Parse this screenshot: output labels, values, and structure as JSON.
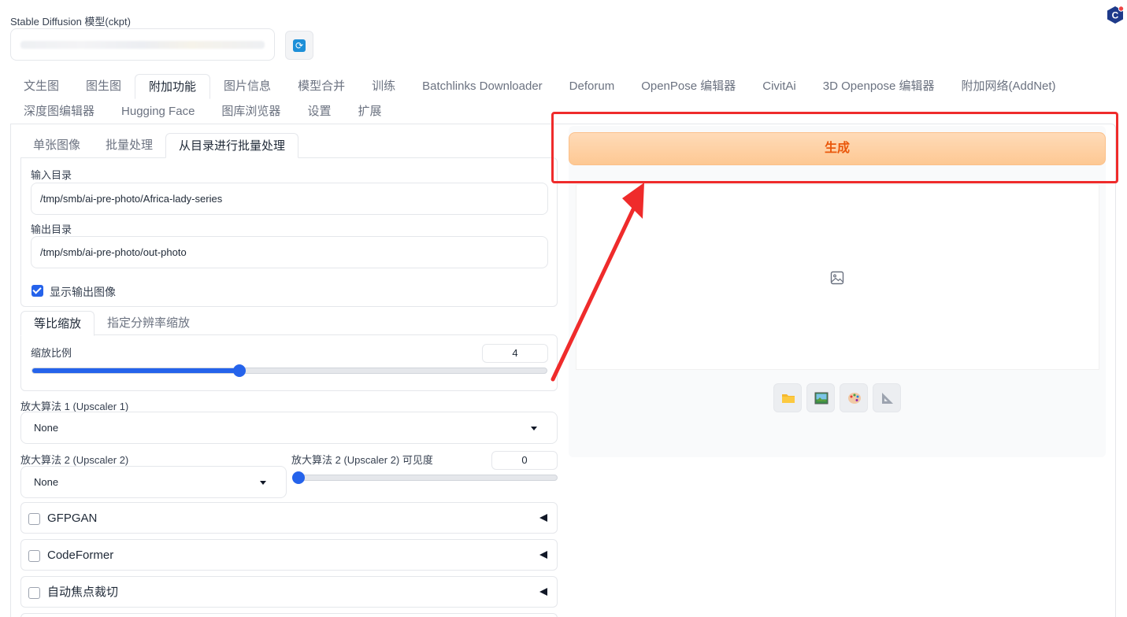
{
  "model": {
    "label": "Stable Diffusion 模型(ckpt)"
  },
  "tabs_row1": [
    "文生图",
    "图生图",
    "附加功能",
    "图片信息",
    "模型合并",
    "训练",
    "Batchlinks Downloader",
    "Deforum",
    "OpenPose 编辑器",
    "CivitAi",
    "3D Openpose 编辑器",
    "附加网络(AddNet)"
  ],
  "tabs_row2": [
    "深度图编辑器",
    "Hugging Face",
    "图库浏览器",
    "设置",
    "扩展"
  ],
  "active_tab": "附加功能",
  "subtabs": [
    "单张图像",
    "批量处理",
    "从目录进行批量处理"
  ],
  "active_subtab": "从目录进行批量处理",
  "batch_dir": {
    "input_label": "输入目录",
    "input_value": "/tmp/smb/ai-pre-photo/Africa-lady-series",
    "output_label": "输出目录",
    "output_value": "/tmp/smb/ai-pre-photo/out-photo",
    "show_output_label": "显示输出图像",
    "show_output_checked": true
  },
  "resize_tabs": [
    "等比缩放",
    "指定分辨率缩放"
  ],
  "active_resize_tab": "等比缩放",
  "scale": {
    "label": "缩放比例",
    "value": "4",
    "min": 1,
    "max": 8
  },
  "upscaler1": {
    "label": "放大算法 1 (Upscaler 1)",
    "value": "None"
  },
  "upscaler2": {
    "label": "放大算法 2 (Upscaler 2)",
    "value": "None"
  },
  "upscaler2_visibility": {
    "label": "放大算法 2 (Upscaler 2) 可见度",
    "value": "0",
    "fraction": 0
  },
  "accordions": [
    {
      "title": "GFPGAN",
      "checked": false
    },
    {
      "title": "CodeFormer",
      "checked": false
    },
    {
      "title": "自动焦点裁切",
      "checked": false
    }
  ],
  "generate_label": "生成",
  "output_tools": [
    "folder-icon",
    "image-icon",
    "palette-icon",
    "ruler-icon"
  ],
  "colors": {
    "accent_blue": "#2563eb",
    "generate_text": "#ea580c",
    "highlight_red": "#ef2b2b"
  }
}
